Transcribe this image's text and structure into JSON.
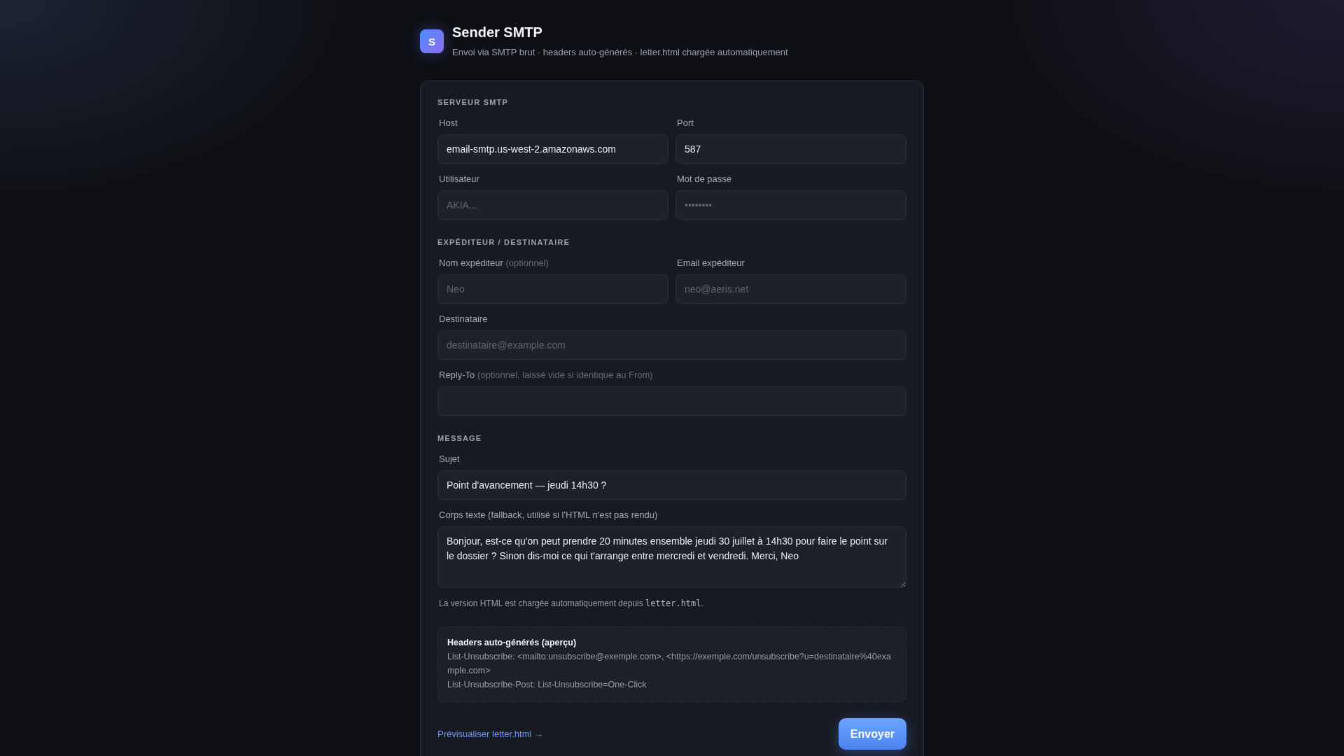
{
  "header": {
    "logo": "S",
    "title": "Sender SMTP",
    "subtitle": "Envoi via SMTP brut · headers auto-générés · letter.html chargée automatiquement"
  },
  "sections": [
    {
      "title": "SERVEUR SMTP",
      "rows": [
        [
          {
            "kind": "input",
            "label": "Host",
            "value": "email-smtp.us-west-2.amazonaws.com"
          },
          {
            "kind": "input",
            "label": "Port",
            "value": "587"
          }
        ],
        [
          {
            "kind": "input",
            "label": "Utilisateur",
            "placeholder": "AKIA..."
          },
          {
            "kind": "input",
            "label": "Mot de passe",
            "placeholder": "••••••••"
          }
        ]
      ]
    },
    {
      "title": "EXPÉDITEUR / DESTINATAIRE",
      "rows": [
        [
          {
            "kind": "input",
            "label": "Nom expéditeur",
            "label_note": "(optionnel)",
            "placeholder": "Neo"
          },
          {
            "kind": "input",
            "label": "Email expéditeur",
            "placeholder": "neo@aeris.net"
          }
        ],
        [
          {
            "kind": "input",
            "label": "Destinataire",
            "placeholder": "destinataire@example.com"
          }
        ],
        [
          {
            "kind": "input",
            "label": "Reply-To",
            "label_note": "(optionnel, laissé vide si identique au From)"
          }
        ]
      ]
    },
    {
      "title": "MESSAGE",
      "rows": [
        [
          {
            "kind": "input",
            "label": "Sujet",
            "value": "Point d'avancement — jeudi 14h30 ?"
          }
        ],
        [
          {
            "kind": "textarea",
            "label": "Corps texte (fallback, utilisé si l'HTML n'est pas rendu)",
            "value": "Bonjour, est-ce qu'on peut prendre 20 minutes ensemble jeudi 30 juillet à 14h30 pour faire le point sur le dossier ? Sinon dis-moi ce qui t'arrange entre mercredi et vendredi. Merci, Neo"
          }
        ]
      ],
      "note": {
        "text_before": "La version HTML est chargée automatiquement depuis ",
        "code": "letter.html",
        "text_after": "."
      }
    }
  ],
  "headers_preview": {
    "title": "Headers auto-générés (aperçu)",
    "lines": [
      "List-Unsubscribe: <mailto:unsubscribe@exemple.com>, <https://exemple.com/unsubscribe?u=destinataire%40example.com>",
      "List-Unsubscribe-Post: List-Unsubscribe=One-Click"
    ]
  },
  "footer": {
    "link": "Prévisualiser letter.html →",
    "button": "Envoyer"
  }
}
